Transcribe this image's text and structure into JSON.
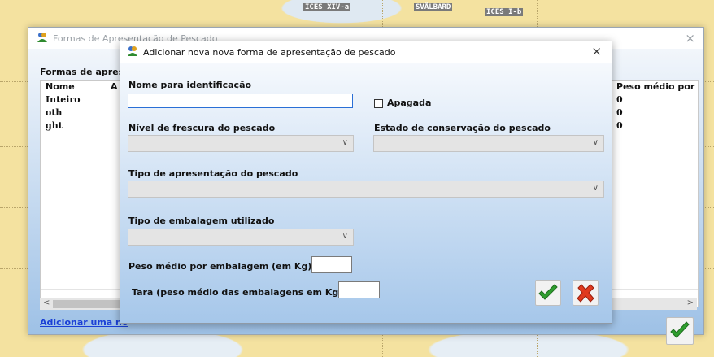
{
  "map": {
    "labels": [
      "ICES XIV-a",
      "SVÅLBARD",
      "ICES I-b"
    ]
  },
  "outer_window": {
    "title": "Formas de Apresentação de Pescado",
    "close_label": "×",
    "list_caption": "Formas de apreso",
    "columns": [
      "Nome",
      "A",
      "Peso médio por"
    ],
    "rows": [
      {
        "nome": "Inteiro",
        "peso": "0"
      },
      {
        "nome": "oth",
        "peso": "0"
      },
      {
        "nome": "ght",
        "peso": "0"
      }
    ],
    "scroll_left": "<",
    "scroll_right": ">",
    "add_link": "Adicionar uma no"
  },
  "dialog": {
    "title": "Adicionar nova nova forma de apresentação de pescado",
    "close_label": "×",
    "nome_label": "Nome para identificação",
    "nome_value": "",
    "apagada_label": "Apagada",
    "frescura_label": "Nível de frescura do pescado",
    "frescura_value": "",
    "conservacao_label": "Estado de conservação do pescado",
    "conservacao_value": "",
    "apresentacao_label": "Tipo de apresentação do pescado",
    "apresentacao_value": "",
    "embalagem_label": "Tipo de embalagem utilizado",
    "embalagem_value": "",
    "peso_label": "Peso médio por embalagem (em Kg):",
    "peso_value": "",
    "tara_label": "Tara (peso médio das embalagens em Kg):",
    "tara_value": "",
    "chevron": "∨"
  },
  "colors": {
    "ok_green": "#2e9e2e",
    "cancel_red": "#e03a1e",
    "link_blue": "#1a3fd6"
  },
  "icons": [
    "app-icon",
    "checkmark-icon",
    "cross-icon",
    "close-icon",
    "chevron-down-icon"
  ]
}
